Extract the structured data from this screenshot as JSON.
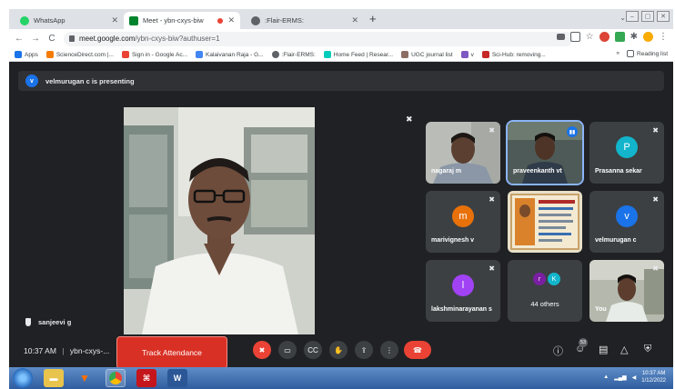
{
  "browser": {
    "tabs": [
      {
        "title": "WhatsApp",
        "active": false,
        "color": "#25d366"
      },
      {
        "title": "Meet - ybn-cxys-biw",
        "active": true,
        "color": "#00832d"
      },
      {
        "title": ":Flair-ERMS:",
        "active": false,
        "color": "#5f6368"
      }
    ],
    "new_tab": "+",
    "url_host": "meet.google.com",
    "url_path": "/ybn-cxys-biw?authuser=1",
    "bookmarks": [
      "Apps",
      "ScienceDirect.com |...",
      "Sign in - Google Ac...",
      "Kalaivanan Raja - G...",
      ":Flair-ERMS:",
      "Home Feed | Resear...",
      "UGC journal list",
      "v",
      "Sci-Hub: removing..."
    ],
    "reading_list": "Reading list",
    "more_bookmarks": "»"
  },
  "meet": {
    "presenting_initial": "v",
    "presenting_text": "velmurugan c is presenting",
    "presenter_name": "sanjeevi g",
    "tiles": [
      {
        "name": "nagaraj m"
      },
      {
        "name": "praveenkanth vt"
      },
      {
        "name": "Prasanna sekar",
        "initial": "P",
        "color": "#12b5cb"
      },
      {
        "name": "marivignesh v",
        "initial": "m",
        "color": "#e8710a"
      },
      {
        "name": "velmurugan c",
        "initial": "v",
        "color": "#1a73e8"
      },
      {
        "name": "lakshminarayanan s",
        "initial": "l",
        "color": "#a142f4"
      },
      {
        "name": "44 others",
        "initials": [
          "r",
          "K"
        ],
        "colors": [
          "#7b1fa2",
          "#12b5cb"
        ]
      },
      {
        "name": "You"
      }
    ],
    "bottom": {
      "time": "10:37 AM",
      "separator": "|",
      "meeting_code": "ybn-cxys-...",
      "track_attendance": "Track Attendance",
      "people_count": "53"
    }
  },
  "taskbar": {
    "clock_time": "10:37 AM",
    "clock_date": "1/12/2022"
  }
}
